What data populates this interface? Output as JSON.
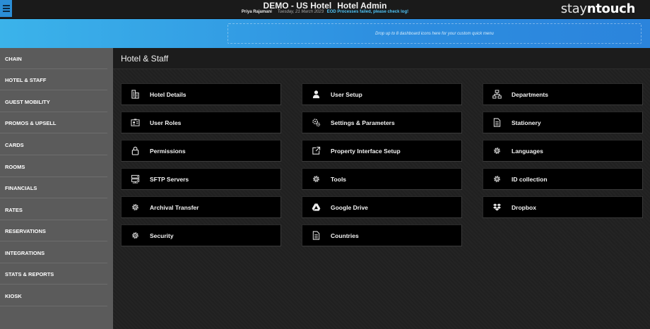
{
  "header": {
    "hotel_name": "DEMO - US Hotel",
    "app_title": "Hotel Admin",
    "user_name": "Priya Rajamani",
    "date": "Tuesday, 21 March 2023",
    "alert": "EOD Processes failed, please check log!",
    "brand_plain": "stay",
    "brand_bold": "ntouch"
  },
  "quickmenu": {
    "dropzone_text": "Drop up to 8 dashboard icons here for your custom quick menu"
  },
  "sidebar": {
    "items": [
      {
        "label": "CHAIN"
      },
      {
        "label": "HOTEL & STAFF"
      },
      {
        "label": "GUEST MOBILITY"
      },
      {
        "label": "PROMOS & UPSELL"
      },
      {
        "label": "CARDS"
      },
      {
        "label": "ROOMS"
      },
      {
        "label": "FINANCIALS"
      },
      {
        "label": "RATES"
      },
      {
        "label": "RESERVATIONS"
      },
      {
        "label": "INTEGRATIONS"
      },
      {
        "label": "STATS & REPORTS"
      },
      {
        "label": "KIOSK"
      }
    ],
    "active": "HOTEL & STAFF"
  },
  "main": {
    "title": "Hotel & Staff",
    "tiles": {
      "hotel_details": {
        "label": "Hotel Details",
        "icon": "building-icon"
      },
      "user_setup": {
        "label": "User Setup",
        "icon": "user-icon"
      },
      "departments": {
        "label": "Departments",
        "icon": "org-chart-icon"
      },
      "user_roles": {
        "label": "User Roles",
        "icon": "id-card-icon"
      },
      "settings_parameters": {
        "label": "Settings & Parameters",
        "icon": "gears-icon"
      },
      "stationery": {
        "label": "Stationery",
        "icon": "document-icon"
      },
      "permissions": {
        "label": "Permissions",
        "icon": "lock-icon"
      },
      "property_interface_setup": {
        "label": "Property Interface Setup",
        "icon": "external-link-icon"
      },
      "languages": {
        "label": "Languages",
        "icon": "gear-icon"
      },
      "sftp_servers": {
        "label": "SFTP Servers",
        "icon": "server-icon"
      },
      "tools": {
        "label": "Tools",
        "icon": "gear-icon"
      },
      "id_collection": {
        "label": "ID collection",
        "icon": "gear-icon"
      },
      "archival_transfer": {
        "label": "Archival Transfer",
        "icon": "gear-icon"
      },
      "google_drive": {
        "label": "Google Drive",
        "icon": "google-drive-icon"
      },
      "dropbox": {
        "label": "Dropbox",
        "icon": "dropbox-icon"
      },
      "security": {
        "label": "Security",
        "icon": "gear-icon"
      },
      "countries": {
        "label": "Countries",
        "icon": "document-icon"
      }
    }
  },
  "colors": {
    "accent_blue": "#2d8ee0",
    "alert_text": "#4fc3f7",
    "sidebar_bg": "#5b5b5b",
    "tile_bg": "#000000"
  }
}
